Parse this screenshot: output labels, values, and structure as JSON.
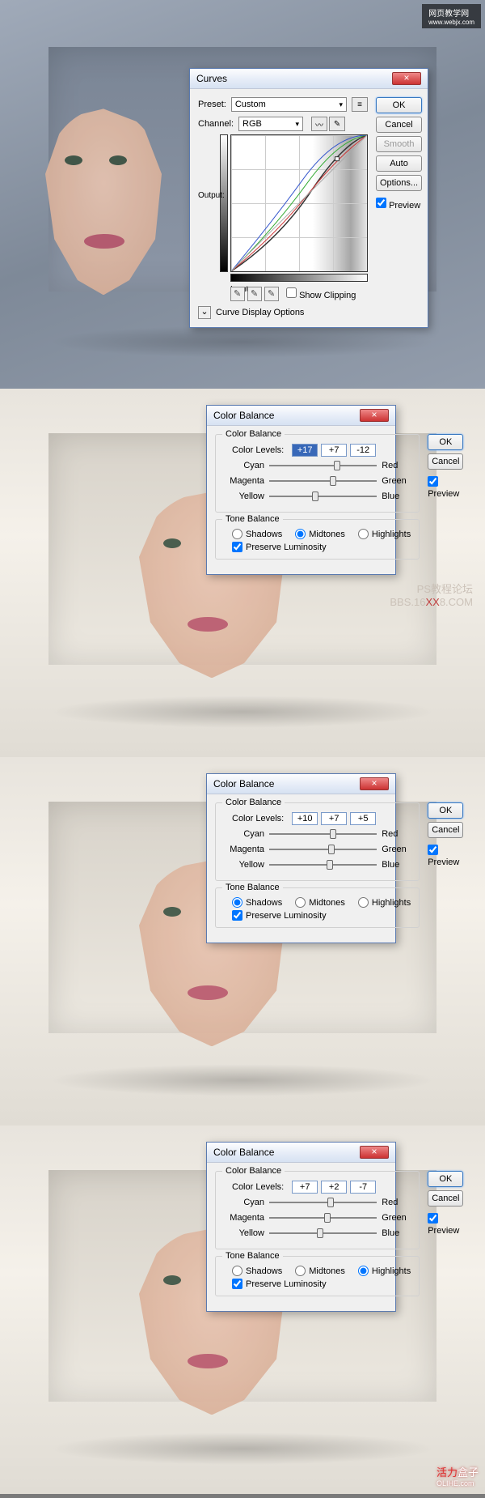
{
  "watermarks": {
    "top_right_cn": "网页教学网",
    "top_right_url": "www.webjx.com",
    "mid_line1": "PS教程论坛",
    "mid_line2a": "BBS.16",
    "mid_line2b": "XX",
    "mid_line2c": "8.COM",
    "br_a": "活力",
    "br_b": "盒子",
    "br_url": "OLIHE.com"
  },
  "curves": {
    "title": "Curves",
    "preset_label": "Preset:",
    "preset_value": "Custom",
    "channel_label": "Channel:",
    "channel_value": "RGB",
    "output_label": "Output:",
    "input_label": "Input:",
    "show_clipping": "Show Clipping",
    "display_options": "Curve Display Options",
    "ok": "OK",
    "cancel": "Cancel",
    "smooth": "Smooth",
    "auto": "Auto",
    "options": "Options...",
    "preview": "Preview"
  },
  "cb": {
    "title": "Color Balance",
    "group1": "Color Balance",
    "levels_label": "Color Levels:",
    "cyan": "Cyan",
    "red": "Red",
    "magenta": "Magenta",
    "green": "Green",
    "yellow": "Yellow",
    "blue": "Blue",
    "group2": "Tone Balance",
    "shadows": "Shadows",
    "midtones": "Midtones",
    "highlights": "Highlights",
    "preserve": "Preserve Luminosity",
    "ok": "OK",
    "cancel": "Cancel",
    "preview": "Preview"
  },
  "cb_panels": [
    {
      "levels": [
        "+17",
        "+7",
        "-12"
      ],
      "tone": "midtones",
      "thumbs": [
        60,
        56,
        40
      ]
    },
    {
      "levels": [
        "+10",
        "+7",
        "+5"
      ],
      "tone": "shadows",
      "thumbs": [
        56,
        55,
        53
      ]
    },
    {
      "levels": [
        "+7",
        "+2",
        "-7"
      ],
      "tone": "highlights",
      "thumbs": [
        54,
        51,
        44
      ]
    }
  ],
  "chart_data": {
    "type": "line",
    "title": "Curves",
    "xlabel": "Input",
    "ylabel": "Output",
    "xlim": [
      0,
      255
    ],
    "ylim": [
      0,
      255
    ],
    "series": [
      {
        "name": "RGB",
        "color": "#333333",
        "points": [
          [
            0,
            0
          ],
          [
            60,
            50
          ],
          [
            128,
            135
          ],
          [
            200,
            225
          ],
          [
            255,
            255
          ]
        ]
      },
      {
        "name": "Red",
        "color": "#cc3030",
        "points": [
          [
            0,
            0
          ],
          [
            64,
            55
          ],
          [
            128,
            130
          ],
          [
            192,
            205
          ],
          [
            255,
            255
          ]
        ]
      },
      {
        "name": "Green",
        "color": "#30a030",
        "points": [
          [
            0,
            0
          ],
          [
            64,
            68
          ],
          [
            128,
            145
          ],
          [
            192,
            215
          ],
          [
            255,
            255
          ]
        ]
      },
      {
        "name": "Blue",
        "color": "#3050c0",
        "points": [
          [
            0,
            0
          ],
          [
            64,
            75
          ],
          [
            128,
            150
          ],
          [
            192,
            212
          ],
          [
            255,
            255
          ]
        ]
      }
    ],
    "histogram_note": "luminosity histogram shown as background, peak near highlights"
  }
}
